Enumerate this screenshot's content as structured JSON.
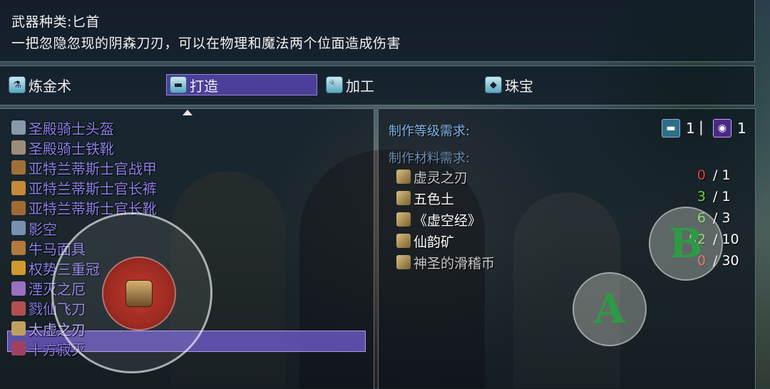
{
  "description": {
    "weapon_type": "武器种类:匕首",
    "text": "一把忽隐忽现的阴森刀刃，可以在物理和魔法两个位面造成伤害"
  },
  "tabs": [
    {
      "label": "炼金术",
      "icon": "alchemy-flask-icon",
      "selected": false
    },
    {
      "label": "打造",
      "icon": "anvil-icon",
      "selected": true
    },
    {
      "label": "加工",
      "icon": "wrench-icon",
      "selected": false
    },
    {
      "label": "珠宝",
      "icon": "jewel-icon",
      "selected": false
    }
  ],
  "items": [
    {
      "label": "圣殿骑士头盔",
      "icon": "helmet-icon",
      "icon_color": "#8899aa"
    },
    {
      "label": "圣殿骑士铁靴",
      "icon": "boots-icon",
      "icon_color": "#9a8d7a"
    },
    {
      "label": "亚特兰蒂斯士官战甲",
      "icon": "armor-icon",
      "icon_color": "#a0703a"
    },
    {
      "label": "亚特兰蒂斯士官长裤",
      "icon": "pants-icon",
      "icon_color": "#c48a3a"
    },
    {
      "label": "亚特兰蒂斯士官长靴",
      "icon": "boots-icon",
      "icon_color": "#a06a35"
    },
    {
      "label": "影空",
      "icon": "dagger-icon",
      "icon_color": "#7a90b0"
    },
    {
      "label": "牛马面具",
      "icon": "mask-icon",
      "icon_color": "#b07a40"
    },
    {
      "label": "权势三重冠",
      "icon": "crown-icon",
      "icon_color": "#d09a30"
    },
    {
      "label": "湮灭之厄",
      "icon": "dagger-icon",
      "icon_color": "#9a70c0"
    },
    {
      "label": "戮仙飞刀",
      "icon": "dagger-icon",
      "icon_color": "#b05050"
    },
    {
      "label": "太虚之刃",
      "icon": "dagger-icon",
      "icon_color": "#c0a060",
      "selected": true
    },
    {
      "label": "十方寂灭",
      "icon": "dagger-icon",
      "icon_color": "#a04060"
    }
  ],
  "requirements": {
    "level_title": "制作等级需求:",
    "levels": [
      {
        "icon": "anvil-icon",
        "value": "1"
      },
      {
        "icon": "spellbook-icon",
        "value": "1"
      }
    ],
    "separator": "|",
    "materials_title": "制作材料需求:",
    "materials": [
      {
        "name": "虚灵之刃",
        "icon": "dagger-icon",
        "name_color": "#c8c8c8",
        "have": "0",
        "need": "/ 1",
        "have_color": "#e04040"
      },
      {
        "name": "五色土",
        "icon": "soil-icon",
        "name_color": "#ffffff",
        "have": "3",
        "need": "/ 1",
        "have_color": "#6fd84a"
      },
      {
        "name": "《虚空经》",
        "icon": "scroll-book-icon",
        "name_color": "#ffffff",
        "have": "6",
        "need": "/ 3",
        "have_color": "#6fd84a"
      },
      {
        "name": "仙韵矿",
        "icon": "ore-icon",
        "name_color": "#ffffff",
        "have": "92",
        "need": "/ 10",
        "have_color": "#6fd84a"
      },
      {
        "name": "神圣的滑稽币",
        "icon": "coin-icon",
        "name_color": "#c8c8c8",
        "have": "0",
        "need": "/ 30",
        "have_color": "#e04040"
      }
    ]
  },
  "controls": {
    "a_label": "A",
    "b_label": "B"
  }
}
